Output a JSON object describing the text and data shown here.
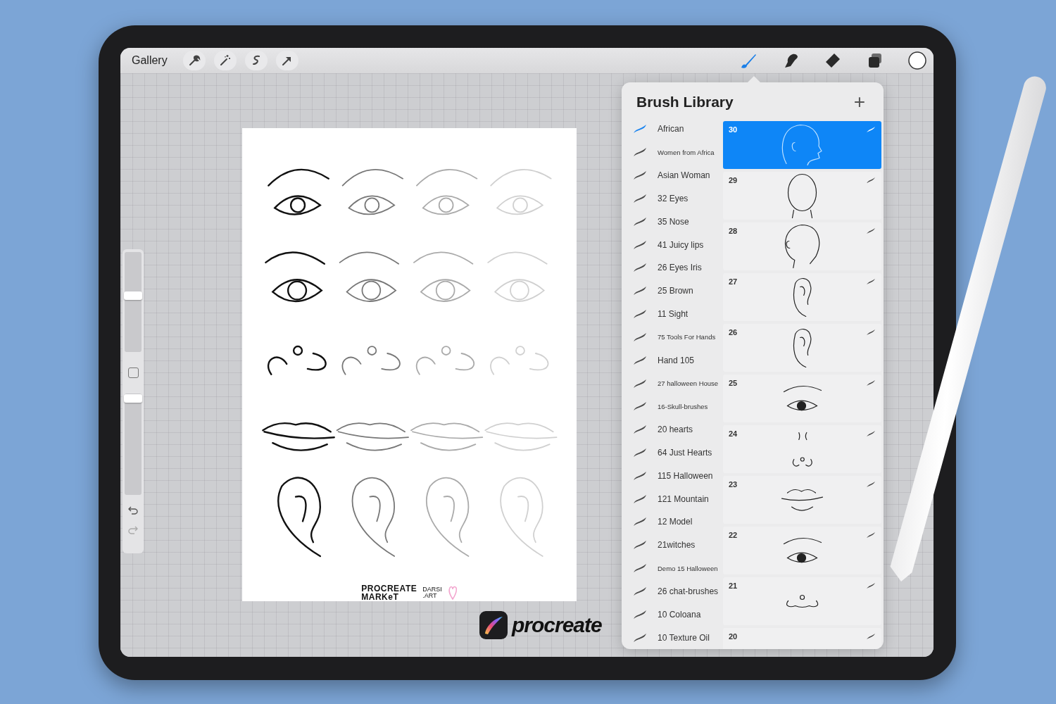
{
  "toolbar": {
    "gallery": "Gallery",
    "left_tools": [
      {
        "kind": "wrench"
      },
      {
        "kind": "wand"
      },
      {
        "kind": "selection"
      },
      {
        "kind": "transform"
      }
    ],
    "right_tools": [
      {
        "kind": "brush",
        "selected": true
      },
      {
        "kind": "smudge",
        "selected": false
      },
      {
        "kind": "eraser",
        "selected": false
      },
      {
        "kind": "layers",
        "selected": false
      },
      {
        "kind": "color",
        "selected": false
      }
    ]
  },
  "sidebar": {
    "size_slider": {
      "level": 0.56
    },
    "opacity_slider": {
      "level": 0.95
    }
  },
  "canvas": {
    "sheet_logos": [
      {
        "kind": "market",
        "lines": [
          "PROCREATE",
          "MARKeT"
        ]
      },
      {
        "kind": "darsi",
        "lines": [
          "DARSI",
          ".ART"
        ]
      }
    ]
  },
  "brush_library": {
    "title": "Brush Library",
    "add": "+",
    "sets": [
      {
        "name": "African",
        "selected": true
      },
      {
        "name": "Women from Africa",
        "selected": false
      },
      {
        "name": "Asian Woman",
        "selected": false
      },
      {
        "name": "32 Eyes",
        "selected": false
      },
      {
        "name": "35 Nose",
        "selected": false
      },
      {
        "name": "41 Juicy lips",
        "selected": false
      },
      {
        "name": "26 Eyes Iris",
        "selected": false
      },
      {
        "name": "25 Brown",
        "selected": false
      },
      {
        "name": "11 Sight",
        "selected": false
      },
      {
        "name": "75 Tools For Hands",
        "selected": false
      },
      {
        "name": "Hand 105",
        "selected": false
      },
      {
        "name": "27 halloween House",
        "selected": false
      },
      {
        "name": "16-Skull-brushes",
        "selected": false
      },
      {
        "name": "20 hearts",
        "selected": false
      },
      {
        "name": "64 Just Hearts",
        "selected": false
      },
      {
        "name": "115 Halloween",
        "selected": false
      },
      {
        "name": "121 Mountain",
        "selected": false
      },
      {
        "name": "12 Model",
        "selected": false
      },
      {
        "name": "21witches",
        "selected": false
      },
      {
        "name": "Demo 15 Halloween",
        "selected": false
      },
      {
        "name": "26 chat-brushes",
        "selected": false
      },
      {
        "name": "10 Coloana",
        "selected": false
      },
      {
        "name": "10 Texture Oil",
        "selected": false
      }
    ],
    "brushes": [
      {
        "number": "30",
        "kind": "head-side",
        "selected": true
      },
      {
        "number": "29",
        "kind": "head-front",
        "selected": false
      },
      {
        "number": "28",
        "kind": "head-back",
        "selected": false
      },
      {
        "number": "27",
        "kind": "ear",
        "selected": false
      },
      {
        "number": "26",
        "kind": "ear",
        "selected": false
      },
      {
        "number": "25",
        "kind": "eye",
        "selected": false
      },
      {
        "number": "24",
        "kind": "nose-long",
        "selected": false
      },
      {
        "number": "23",
        "kind": "lips",
        "selected": false
      },
      {
        "number": "22",
        "kind": "eye",
        "selected": false
      },
      {
        "number": "21",
        "kind": "nose",
        "selected": false
      },
      {
        "number": "20",
        "kind": "blank",
        "selected": false
      }
    ]
  },
  "app_logo": {
    "wordmark": "procreate"
  }
}
